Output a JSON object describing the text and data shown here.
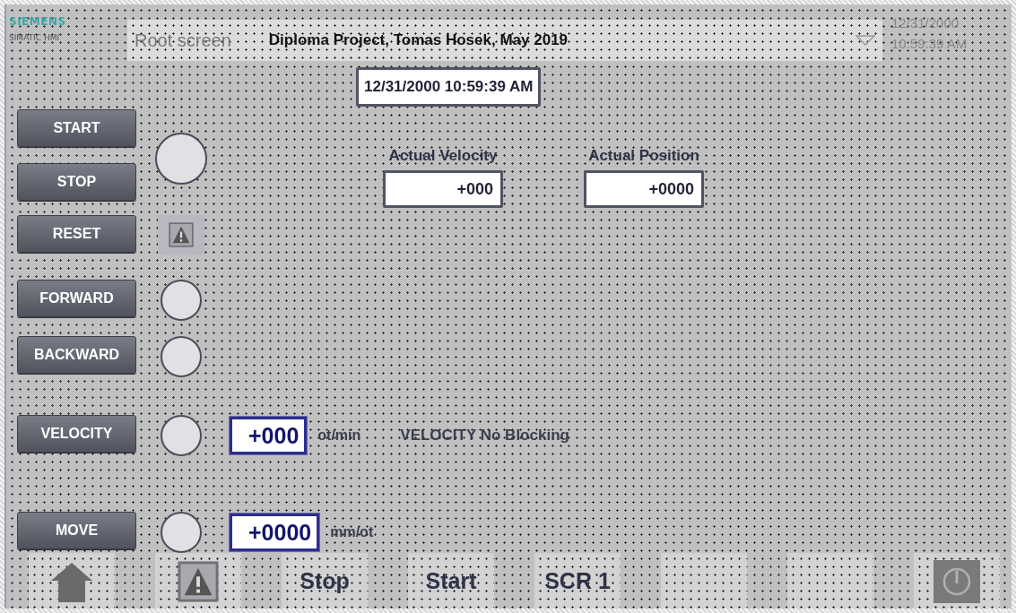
{
  "header": {
    "brand": "SIEMENS",
    "product": "SIMATIC HMI",
    "screen_name": "Root screen",
    "title": "Diploma Project, Tomas Hosek, May 2019",
    "date": "12/31/2000",
    "time": "10:59:39 AM"
  },
  "datetime_field": "12/31/2000 10:59:39 AM",
  "readouts": [
    {
      "label": "Actual Velocity",
      "value": "+000"
    },
    {
      "label": "Actual Position",
      "value": "+0000"
    }
  ],
  "groups": [
    {
      "buttons": [
        "START",
        "STOP"
      ],
      "indicator": {
        "kind": "lamp_large"
      }
    },
    {
      "buttons": [
        "RESET"
      ],
      "indicator": {
        "kind": "alarm"
      }
    },
    {
      "buttons": [
        "FORWARD"
      ],
      "indicator": {
        "kind": "lamp"
      }
    },
    {
      "buttons": [
        "BACKWARD"
      ],
      "indicator": {
        "kind": "lamp"
      }
    },
    {
      "buttons": [
        "VELOCITY"
      ],
      "indicator": {
        "kind": "lamp"
      },
      "input": "+000",
      "unit": "ot/min",
      "status": "VELOCITY No Blocking"
    },
    {
      "buttons": [
        "MOVE"
      ],
      "indicator": {
        "kind": "lamp"
      },
      "input": "+0000",
      "unit": "mm/ot"
    }
  ],
  "function_keys": [
    {
      "kind": "home"
    },
    {
      "kind": "alarm"
    },
    {
      "kind": "text",
      "label": "Stop"
    },
    {
      "kind": "text",
      "label": "Start"
    },
    {
      "kind": "text",
      "label": "SCR 1"
    },
    {
      "kind": "blank"
    },
    {
      "kind": "blank"
    },
    {
      "kind": "power"
    }
  ]
}
